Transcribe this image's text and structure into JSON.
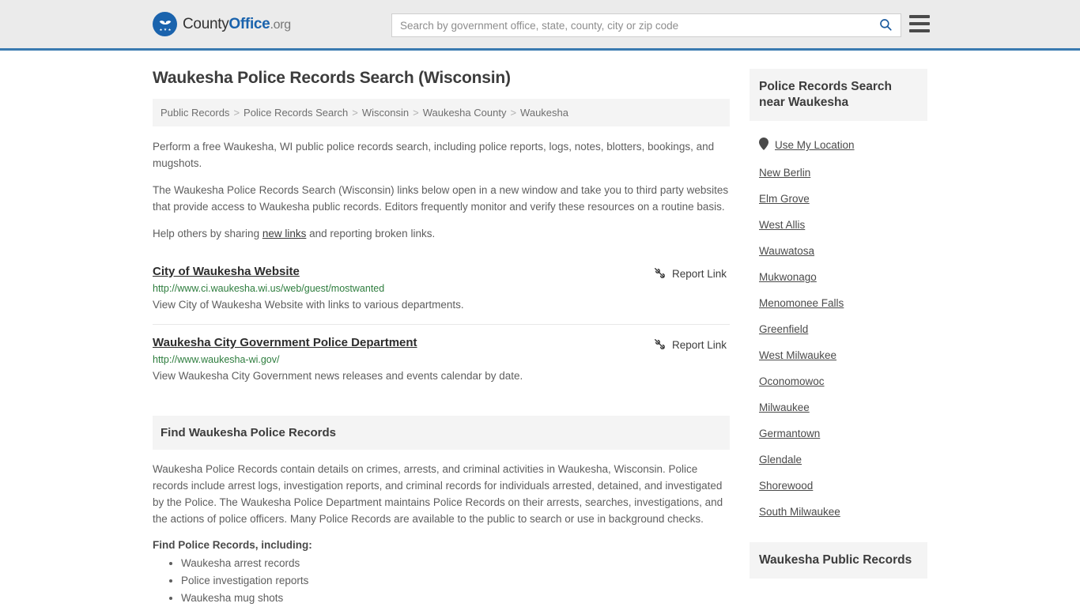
{
  "header": {
    "logo": {
      "icon": "eagle-badge-icon",
      "text_primary": "County",
      "text_bold": "Office",
      "text_suffix": ".org"
    },
    "search": {
      "placeholder": "Search by government office, state, county, city or zip code",
      "value": "",
      "icon": "search-icon"
    },
    "menu_icon": "hamburger-menu-icon",
    "accent_color": "#3a7ab0"
  },
  "main": {
    "title": "Waukesha Police Records Search (Wisconsin)",
    "breadcrumb": [
      "Public Records",
      "Police Records Search",
      "Wisconsin",
      "Waukesha County",
      "Waukesha"
    ],
    "breadcrumb_separator": ">",
    "intro_paragraphs": [
      "Perform a free Waukesha, WI public police records search, including police reports, logs, notes, blotters, bookings, and mugshots.",
      "The Waukesha Police Records Search (Wisconsin) links below open in a new window and take you to third party websites that provide access to Waukesha public records. Editors frequently monitor and verify these resources on a routine basis."
    ],
    "help_text_before": "Help others by sharing ",
    "help_link": "new links",
    "help_text_after": " and reporting broken links.",
    "report_link_label": "Report Link",
    "report_link_icon": "broken-link-icon",
    "links": [
      {
        "title": "City of Waukesha Website",
        "url": "http://www.ci.waukesha.wi.us/web/guest/mostwanted",
        "description": "View City of Waukesha Website with links to various departments."
      },
      {
        "title": "Waukesha City Government Police Department",
        "url": "http://www.waukesha-wi.gov/",
        "description": "View Waukesha City Government news releases and events calendar by date."
      }
    ],
    "find_section": {
      "heading": "Find Waukesha Police Records",
      "paragraph": "Waukesha Police Records contain details on crimes, arrests, and criminal activities in Waukesha, Wisconsin. Police records include arrest logs, investigation reports, and criminal records for individuals arrested, detained, and investigated by the Police. The Waukesha Police Department maintains Police Records on their arrests, searches, investigations, and the actions of police officers. Many Police Records are available to the public to search or use in background checks.",
      "subheading": "Find Police Records, including:",
      "bullets": [
        "Waukesha arrest records",
        "Police investigation reports",
        "Waukesha mug shots"
      ]
    }
  },
  "sidebar": {
    "heading": "Police Records Search near Waukesha",
    "use_my_location": {
      "label": "Use My Location",
      "icon": "map-pin-icon"
    },
    "nearby": [
      "New Berlin",
      "Elm Grove",
      "West Allis",
      "Wauwatosa",
      "Mukwonago",
      "Menomonee Falls",
      "Greenfield",
      "West Milwaukee",
      "Oconomowoc",
      "Milwaukee",
      "Germantown",
      "Glendale",
      "Shorewood",
      "South Milwaukee"
    ],
    "second_heading": "Waukesha Public Records"
  }
}
